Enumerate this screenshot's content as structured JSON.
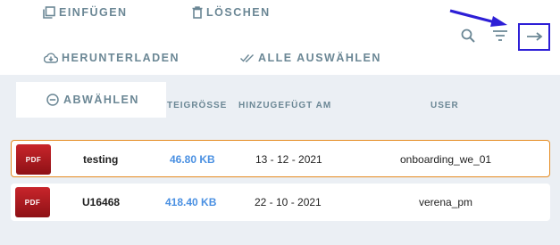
{
  "toolbar": {
    "paste_label": "EINFÜGEN",
    "delete_label": "LÖSCHEN",
    "download_label": "HERUNTERLADEN",
    "select_all_label": "ALLE AUSWÄHLEN",
    "deselect_label": "ABWÄHLEN",
    "icons": [
      "copy-icon",
      "trash-icon",
      "cloud-download-icon",
      "double-check-icon",
      "minus-circle-icon",
      "search-icon",
      "filter-icon",
      "arrow-right-icon"
    ]
  },
  "table": {
    "columns": [
      "TEIGRÖSSE",
      "HINZUGEFÜGT AM",
      "USER"
    ],
    "rows": [
      {
        "type": "PDF",
        "name": "testing",
        "size": "46.80 KB",
        "date": "13 - 12 - 2021",
        "user": "onboarding_we_01",
        "selected": true
      },
      {
        "type": "PDF",
        "name": "U16468",
        "size": "418.40 KB",
        "date": "22 - 10 - 2021",
        "user": "verena_pm",
        "selected": false
      }
    ]
  },
  "colors": {
    "accent_label": "#6b8795",
    "size_blue": "#4a90e2",
    "selected_border": "#e58a1f",
    "annotation": "#2d1fd6",
    "pdf_red": "#c8252b"
  }
}
